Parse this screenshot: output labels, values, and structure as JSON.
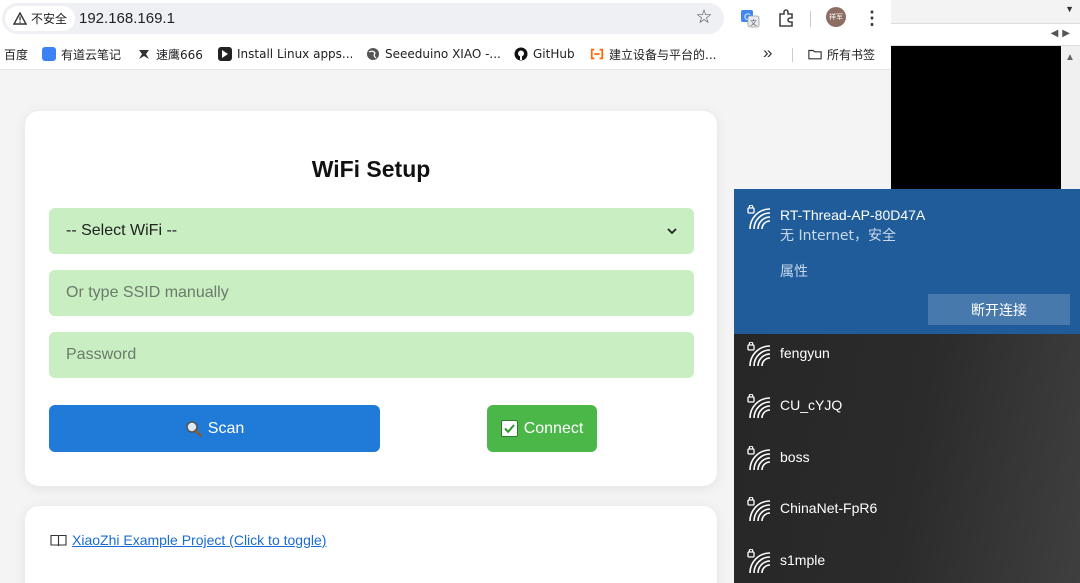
{
  "browser": {
    "security_label": "不安全",
    "url": "192.168.169.1",
    "avatar_text": "祥军"
  },
  "bookmarks": [
    {
      "label": "百度",
      "icon": "baidu-icon"
    },
    {
      "label": "有道云笔记",
      "icon": "youdao-note-icon",
      "color": "#3c82f6"
    },
    {
      "label": "速鹰666",
      "icon": "eagle-icon"
    },
    {
      "label": "Install Linux apps...",
      "icon": "arrow-app-icon"
    },
    {
      "label": "Seeeduino XIAO -...",
      "icon": "globe-icon"
    },
    {
      "label": "GitHub",
      "icon": "github-icon"
    },
    {
      "label": "建立设备与平台的...",
      "icon": "aliyun-icon",
      "color": "#ff6a00"
    },
    {
      "label": "所有书签",
      "icon": "folder-icon"
    }
  ],
  "wifi_setup": {
    "title": "WiFi Setup",
    "select_value": "-- Select WiFi --",
    "ssid_placeholder": "Or type SSID manually",
    "password_placeholder": "Password",
    "scan_label": "Scan",
    "connect_label": "Connect",
    "field_color": "#c8eec2",
    "scan_color": "#1f7ad8",
    "connect_color": "#4cb749"
  },
  "project": {
    "link_label": "XiaoZhi Example Project (Click to toggle)",
    "icon": "book-icon"
  },
  "wifi_flyout": {
    "connected": {
      "name": "RT-Thread-AP-80D47A",
      "status": "无 Internet，安全",
      "properties_label": "属性",
      "disconnect_label": "断开连接"
    },
    "networks": [
      {
        "name": "fengyun"
      },
      {
        "name": "CU_cYJQ"
      },
      {
        "name": "boss"
      },
      {
        "name": "ChinaNet-FpR6"
      },
      {
        "name": "s1mple"
      }
    ],
    "active_color": "#1f5c99"
  }
}
